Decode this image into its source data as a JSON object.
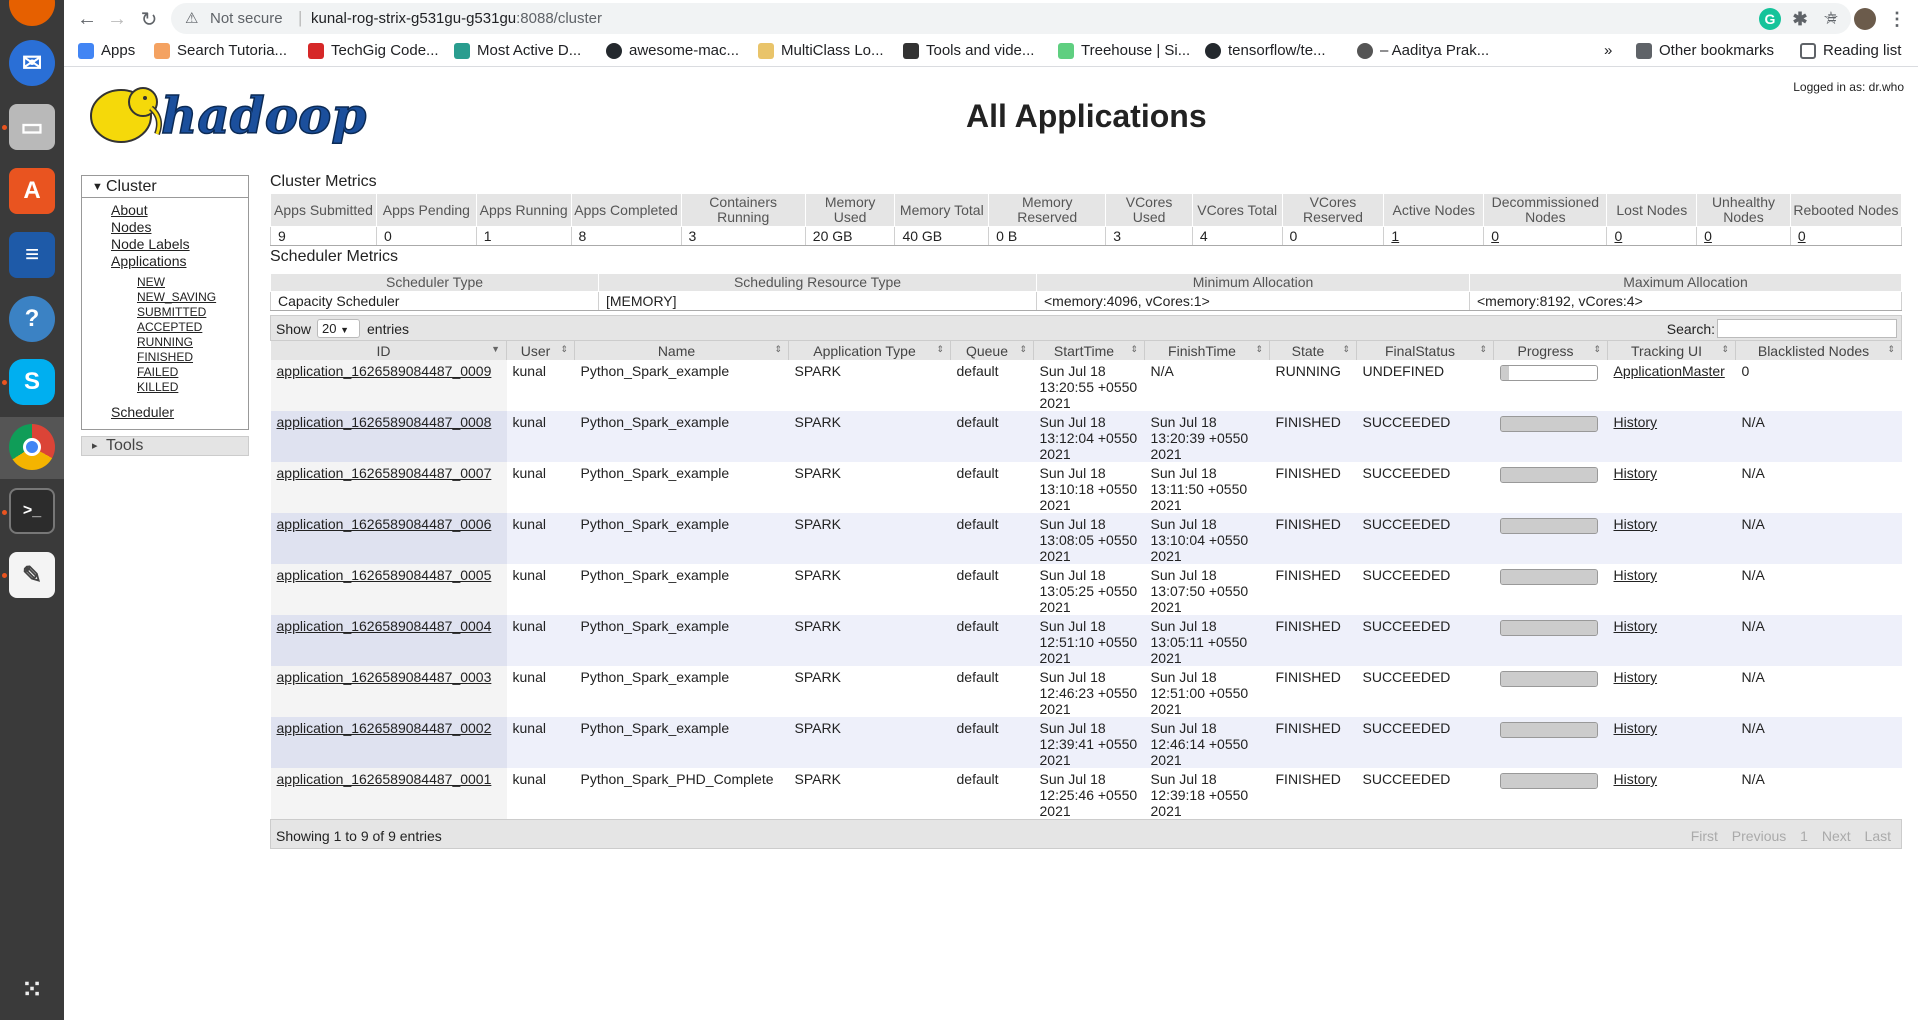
{
  "browser": {
    "not_secure": "Not secure",
    "url_host": "kunal-rog-strix-g531gu-g531gu",
    "url_path": ":8088/cluster",
    "bookmarks": [
      {
        "label": "Apps",
        "color": "#4285f4"
      },
      {
        "label": "Search Tutoria...",
        "color": "#f4a261"
      },
      {
        "label": "TechGig Code...",
        "color": "#d62828"
      },
      {
        "label": "Most Active D...",
        "color": "#2a9d8f"
      },
      {
        "label": "awesome-mac...",
        "color": "#24292e"
      },
      {
        "label": "MultiClass Lo...",
        "color": "#e9c46a"
      },
      {
        "label": "Tools and vide...",
        "color": "#333333"
      },
      {
        "label": "Treehouse | Si...",
        "color": "#5fcf80"
      },
      {
        "label": "tensorflow/te...",
        "color": "#24292e"
      },
      {
        "label": "– Aaditya Prak...",
        "color": "#555555"
      }
    ],
    "other_bookmarks": "Other bookmarks",
    "reading_list": "Reading list"
  },
  "header": {
    "logo_text": "hadoop",
    "title": "All Applications",
    "logged_in": "Logged in as: dr.who"
  },
  "nav": {
    "cluster": "Cluster",
    "links": [
      "About",
      "Nodes",
      "Node Labels",
      "Applications"
    ],
    "states": [
      "NEW",
      "NEW_SAVING",
      "SUBMITTED",
      "ACCEPTED",
      "RUNNING",
      "FINISHED",
      "FAILED",
      "KILLED"
    ],
    "scheduler": "Scheduler",
    "tools": "Tools"
  },
  "cluster_metrics": {
    "title": "Cluster Metrics",
    "headers": [
      "Apps Submitted",
      "Apps Pending",
      "Apps Running",
      "Apps Completed",
      "Containers Running",
      "Memory Used",
      "Memory Total",
      "Memory Reserved",
      "VCores Used",
      "VCores Total",
      "VCores Reserved",
      "Active Nodes",
      "Decommissioned Nodes",
      "Lost Nodes",
      "Unhealthy Nodes",
      "Rebooted Nodes"
    ],
    "values": [
      "9",
      "0",
      "1",
      "8",
      "3",
      "20 GB",
      "40 GB",
      "0 B",
      "3",
      "4",
      "0",
      "1",
      "0",
      "0",
      "0",
      "0"
    ]
  },
  "scheduler_metrics": {
    "title": "Scheduler Metrics",
    "headers": [
      "Scheduler Type",
      "Scheduling Resource Type",
      "Minimum Allocation",
      "Maximum Allocation"
    ],
    "values": [
      "Capacity Scheduler",
      "[MEMORY]",
      "<memory:4096, vCores:1>",
      "<memory:8192, vCores:4>"
    ]
  },
  "apps_table": {
    "show_label": "Show",
    "page_size": "20",
    "entries_label": "entries",
    "search_label": "Search:",
    "columns": [
      "ID",
      "User",
      "Name",
      "Application Type",
      "Queue",
      "StartTime",
      "FinishTime",
      "State",
      "FinalStatus",
      "Progress",
      "Tracking UI",
      "Blacklisted Nodes"
    ],
    "rows": [
      {
        "id": "application_1626589084487_0009",
        "user": "kunal",
        "name": "Python_Spark_example",
        "type": "SPARK",
        "queue": "default",
        "start": "Sun Jul 18 13:20:55 +0550 2021",
        "finish": "N/A",
        "state": "RUNNING",
        "final": "UNDEFINED",
        "progress": 0.1,
        "tracking": "ApplicationMaster",
        "blacklisted": "0"
      },
      {
        "id": "application_1626589084487_0008",
        "user": "kunal",
        "name": "Python_Spark_example",
        "type": "SPARK",
        "queue": "default",
        "start": "Sun Jul 18 13:12:04 +0550 2021",
        "finish": "Sun Jul 18 13:20:39 +0550 2021",
        "state": "FINISHED",
        "final": "SUCCEEDED",
        "progress": 1,
        "tracking": "History",
        "blacklisted": "N/A"
      },
      {
        "id": "application_1626589084487_0007",
        "user": "kunal",
        "name": "Python_Spark_example",
        "type": "SPARK",
        "queue": "default",
        "start": "Sun Jul 18 13:10:18 +0550 2021",
        "finish": "Sun Jul 18 13:11:50 +0550 2021",
        "state": "FINISHED",
        "final": "SUCCEEDED",
        "progress": 1,
        "tracking": "History",
        "blacklisted": "N/A"
      },
      {
        "id": "application_1626589084487_0006",
        "user": "kunal",
        "name": "Python_Spark_example",
        "type": "SPARK",
        "queue": "default",
        "start": "Sun Jul 18 13:08:05 +0550 2021",
        "finish": "Sun Jul 18 13:10:04 +0550 2021",
        "state": "FINISHED",
        "final": "SUCCEEDED",
        "progress": 1,
        "tracking": "History",
        "blacklisted": "N/A"
      },
      {
        "id": "application_1626589084487_0005",
        "user": "kunal",
        "name": "Python_Spark_example",
        "type": "SPARK",
        "queue": "default",
        "start": "Sun Jul 18 13:05:25 +0550 2021",
        "finish": "Sun Jul 18 13:07:50 +0550 2021",
        "state": "FINISHED",
        "final": "SUCCEEDED",
        "progress": 1,
        "tracking": "History",
        "blacklisted": "N/A"
      },
      {
        "id": "application_1626589084487_0004",
        "user": "kunal",
        "name": "Python_Spark_example",
        "type": "SPARK",
        "queue": "default",
        "start": "Sun Jul 18 12:51:10 +0550 2021",
        "finish": "Sun Jul 18 13:05:11 +0550 2021",
        "state": "FINISHED",
        "final": "SUCCEEDED",
        "progress": 1,
        "tracking": "History",
        "blacklisted": "N/A"
      },
      {
        "id": "application_1626589084487_0003",
        "user": "kunal",
        "name": "Python_Spark_example",
        "type": "SPARK",
        "queue": "default",
        "start": "Sun Jul 18 12:46:23 +0550 2021",
        "finish": "Sun Jul 18 12:51:00 +0550 2021",
        "state": "FINISHED",
        "final": "SUCCEEDED",
        "progress": 1,
        "tracking": "History",
        "blacklisted": "N/A"
      },
      {
        "id": "application_1626589084487_0002",
        "user": "kunal",
        "name": "Python_Spark_example",
        "type": "SPARK",
        "queue": "default",
        "start": "Sun Jul 18 12:39:41 +0550 2021",
        "finish": "Sun Jul 18 12:46:14 +0550 2021",
        "state": "FINISHED",
        "final": "SUCCEEDED",
        "progress": 1,
        "tracking": "History",
        "blacklisted": "N/A"
      },
      {
        "id": "application_1626589084487_0001",
        "user": "kunal",
        "name": "Python_Spark_PHD_Complete",
        "type": "SPARK",
        "queue": "default",
        "start": "Sun Jul 18 12:25:46 +0550 2021",
        "finish": "Sun Jul 18 12:39:18 +0550 2021",
        "state": "FINISHED",
        "final": "SUCCEEDED",
        "progress": 1,
        "tracking": "History",
        "blacklisted": "N/A"
      }
    ],
    "showing": "Showing 1 to 9 of 9 entries",
    "pager": [
      "First",
      "Previous",
      "1",
      "Next",
      "Last"
    ]
  }
}
